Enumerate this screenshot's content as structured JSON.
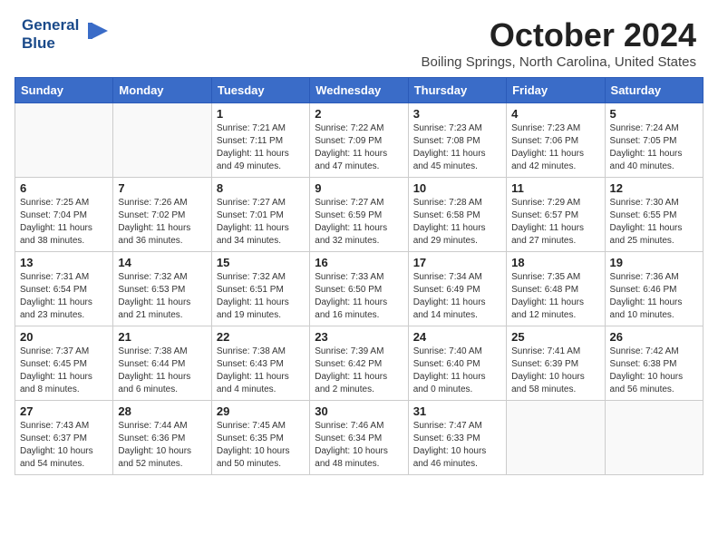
{
  "header": {
    "logo_line1": "General",
    "logo_line2": "Blue",
    "month_title": "October 2024",
    "subtitle": "Boiling Springs, North Carolina, United States"
  },
  "days_of_week": [
    "Sunday",
    "Monday",
    "Tuesday",
    "Wednesday",
    "Thursday",
    "Friday",
    "Saturday"
  ],
  "weeks": [
    [
      {
        "num": "",
        "info": ""
      },
      {
        "num": "",
        "info": ""
      },
      {
        "num": "1",
        "info": "Sunrise: 7:21 AM\nSunset: 7:11 PM\nDaylight: 11 hours and 49 minutes."
      },
      {
        "num": "2",
        "info": "Sunrise: 7:22 AM\nSunset: 7:09 PM\nDaylight: 11 hours and 47 minutes."
      },
      {
        "num": "3",
        "info": "Sunrise: 7:23 AM\nSunset: 7:08 PM\nDaylight: 11 hours and 45 minutes."
      },
      {
        "num": "4",
        "info": "Sunrise: 7:23 AM\nSunset: 7:06 PM\nDaylight: 11 hours and 42 minutes."
      },
      {
        "num": "5",
        "info": "Sunrise: 7:24 AM\nSunset: 7:05 PM\nDaylight: 11 hours and 40 minutes."
      }
    ],
    [
      {
        "num": "6",
        "info": "Sunrise: 7:25 AM\nSunset: 7:04 PM\nDaylight: 11 hours and 38 minutes."
      },
      {
        "num": "7",
        "info": "Sunrise: 7:26 AM\nSunset: 7:02 PM\nDaylight: 11 hours and 36 minutes."
      },
      {
        "num": "8",
        "info": "Sunrise: 7:27 AM\nSunset: 7:01 PM\nDaylight: 11 hours and 34 minutes."
      },
      {
        "num": "9",
        "info": "Sunrise: 7:27 AM\nSunset: 6:59 PM\nDaylight: 11 hours and 32 minutes."
      },
      {
        "num": "10",
        "info": "Sunrise: 7:28 AM\nSunset: 6:58 PM\nDaylight: 11 hours and 29 minutes."
      },
      {
        "num": "11",
        "info": "Sunrise: 7:29 AM\nSunset: 6:57 PM\nDaylight: 11 hours and 27 minutes."
      },
      {
        "num": "12",
        "info": "Sunrise: 7:30 AM\nSunset: 6:55 PM\nDaylight: 11 hours and 25 minutes."
      }
    ],
    [
      {
        "num": "13",
        "info": "Sunrise: 7:31 AM\nSunset: 6:54 PM\nDaylight: 11 hours and 23 minutes."
      },
      {
        "num": "14",
        "info": "Sunrise: 7:32 AM\nSunset: 6:53 PM\nDaylight: 11 hours and 21 minutes."
      },
      {
        "num": "15",
        "info": "Sunrise: 7:32 AM\nSunset: 6:51 PM\nDaylight: 11 hours and 19 minutes."
      },
      {
        "num": "16",
        "info": "Sunrise: 7:33 AM\nSunset: 6:50 PM\nDaylight: 11 hours and 16 minutes."
      },
      {
        "num": "17",
        "info": "Sunrise: 7:34 AM\nSunset: 6:49 PM\nDaylight: 11 hours and 14 minutes."
      },
      {
        "num": "18",
        "info": "Sunrise: 7:35 AM\nSunset: 6:48 PM\nDaylight: 11 hours and 12 minutes."
      },
      {
        "num": "19",
        "info": "Sunrise: 7:36 AM\nSunset: 6:46 PM\nDaylight: 11 hours and 10 minutes."
      }
    ],
    [
      {
        "num": "20",
        "info": "Sunrise: 7:37 AM\nSunset: 6:45 PM\nDaylight: 11 hours and 8 minutes."
      },
      {
        "num": "21",
        "info": "Sunrise: 7:38 AM\nSunset: 6:44 PM\nDaylight: 11 hours and 6 minutes."
      },
      {
        "num": "22",
        "info": "Sunrise: 7:38 AM\nSunset: 6:43 PM\nDaylight: 11 hours and 4 minutes."
      },
      {
        "num": "23",
        "info": "Sunrise: 7:39 AM\nSunset: 6:42 PM\nDaylight: 11 hours and 2 minutes."
      },
      {
        "num": "24",
        "info": "Sunrise: 7:40 AM\nSunset: 6:40 PM\nDaylight: 11 hours and 0 minutes."
      },
      {
        "num": "25",
        "info": "Sunrise: 7:41 AM\nSunset: 6:39 PM\nDaylight: 10 hours and 58 minutes."
      },
      {
        "num": "26",
        "info": "Sunrise: 7:42 AM\nSunset: 6:38 PM\nDaylight: 10 hours and 56 minutes."
      }
    ],
    [
      {
        "num": "27",
        "info": "Sunrise: 7:43 AM\nSunset: 6:37 PM\nDaylight: 10 hours and 54 minutes."
      },
      {
        "num": "28",
        "info": "Sunrise: 7:44 AM\nSunset: 6:36 PM\nDaylight: 10 hours and 52 minutes."
      },
      {
        "num": "29",
        "info": "Sunrise: 7:45 AM\nSunset: 6:35 PM\nDaylight: 10 hours and 50 minutes."
      },
      {
        "num": "30",
        "info": "Sunrise: 7:46 AM\nSunset: 6:34 PM\nDaylight: 10 hours and 48 minutes."
      },
      {
        "num": "31",
        "info": "Sunrise: 7:47 AM\nSunset: 6:33 PM\nDaylight: 10 hours and 46 minutes."
      },
      {
        "num": "",
        "info": ""
      },
      {
        "num": "",
        "info": ""
      }
    ]
  ]
}
